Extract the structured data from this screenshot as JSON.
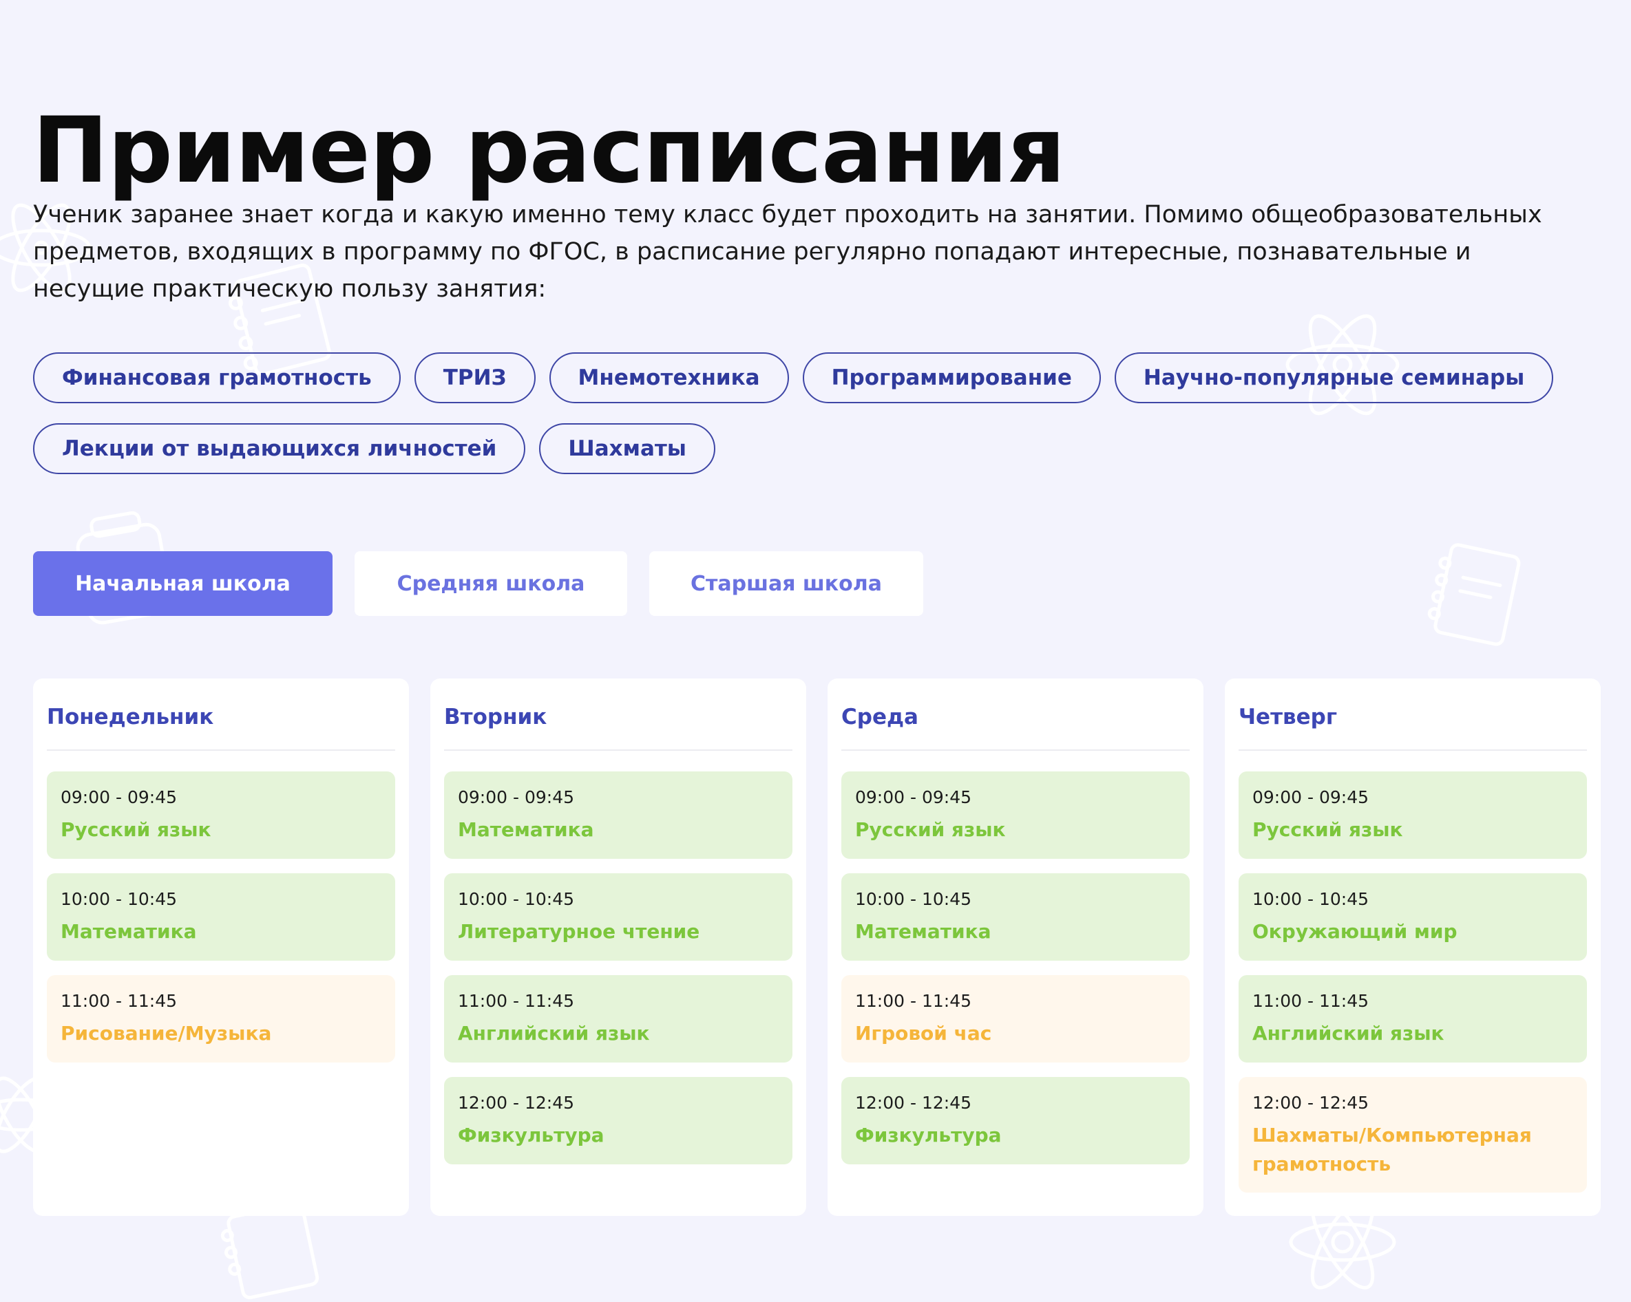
{
  "page": {
    "title": "Пример расписания",
    "intro": "Ученик заранее знает когда и какую именно тему класс будет проходить на занятии. Помимо общеобразовательных предметов, входящих в программу по ФГОС, в расписание регулярно попадают интересные, познавательные и несущие практическую пользу занятия:"
  },
  "chips": [
    "Финансовая грамотность",
    "ТРИЗ",
    "Мнемотехника",
    "Программирование",
    "Научно-популярные семинары",
    "Лекции от выдающихся личностей",
    "Шахматы"
  ],
  "tabs": [
    {
      "label": "Начальная школа",
      "active": true
    },
    {
      "label": "Средняя школа",
      "active": false
    },
    {
      "label": "Старшая школа",
      "active": false
    }
  ],
  "colors": {
    "accent": "#6a71ea",
    "chip_text": "#2f3a9c",
    "day_title": "#3c46b4",
    "lesson_green_bg": "#e5f4d9",
    "lesson_green_text": "#7cc63c",
    "lesson_orange_bg": "#fff7ec",
    "lesson_orange_text": "#f5b53a",
    "background": "#f3f3fd"
  },
  "days": [
    {
      "name": "Понедельник",
      "lessons": [
        {
          "time": "09:00 - 09:45",
          "subject": "Русский язык",
          "color": "green"
        },
        {
          "time": "10:00 - 10:45",
          "subject": "Математика",
          "color": "green"
        },
        {
          "time": "11:00 - 11:45",
          "subject": "Рисование/Музыка",
          "color": "orange"
        }
      ]
    },
    {
      "name": "Вторник",
      "lessons": [
        {
          "time": "09:00 - 09:45",
          "subject": "Математика",
          "color": "green"
        },
        {
          "time": "10:00 - 10:45",
          "subject": "Литературное чтение",
          "color": "green"
        },
        {
          "time": "11:00 - 11:45",
          "subject": "Английский язык",
          "color": "green"
        },
        {
          "time": "12:00 - 12:45",
          "subject": "Физкультура",
          "color": "green"
        }
      ]
    },
    {
      "name": "Среда",
      "lessons": [
        {
          "time": "09:00 - 09:45",
          "subject": "Русский язык",
          "color": "green"
        },
        {
          "time": "10:00 - 10:45",
          "subject": "Математика",
          "color": "green"
        },
        {
          "time": "11:00 - 11:45",
          "subject": "Игровой час",
          "color": "orange"
        },
        {
          "time": "12:00 - 12:45",
          "subject": "Физкультура",
          "color": "green"
        }
      ]
    },
    {
      "name": "Четверг",
      "lessons": [
        {
          "time": "09:00 - 09:45",
          "subject": "Русский язык",
          "color": "green"
        },
        {
          "time": "10:00 - 10:45",
          "subject": "Окружающий мир",
          "color": "green"
        },
        {
          "time": "11:00 - 11:45",
          "subject": "Английский язык",
          "color": "green"
        },
        {
          "time": "12:00 - 12:45",
          "subject": "Шахматы/Компьютерная грамотность",
          "color": "orange"
        }
      ]
    }
  ]
}
